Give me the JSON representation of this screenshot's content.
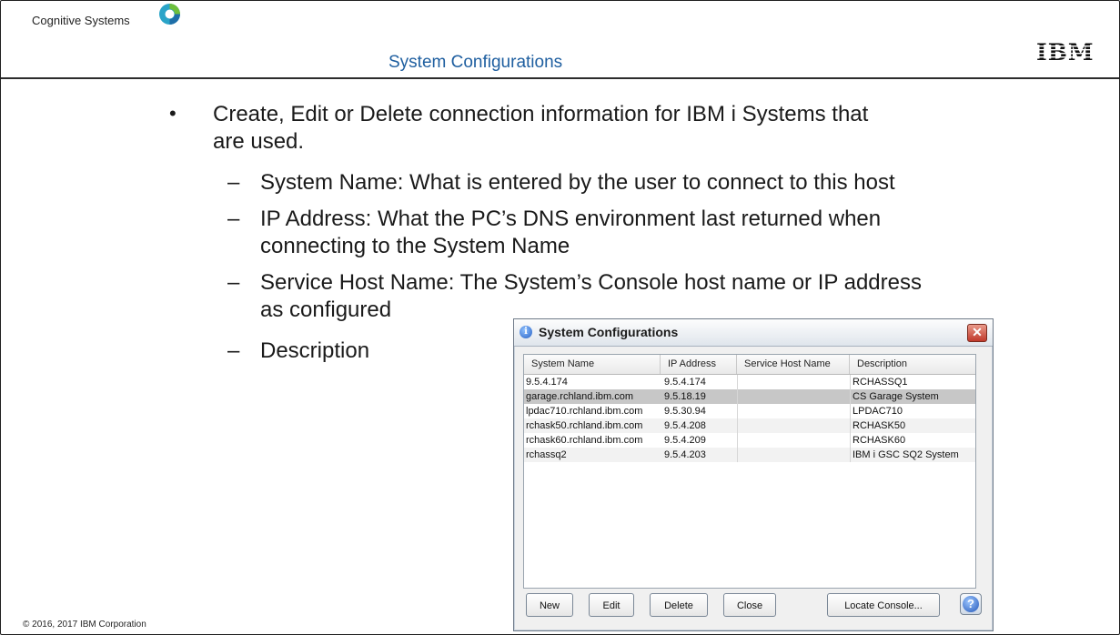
{
  "header": {
    "brand": "Cognitive Systems",
    "title": "System Configurations",
    "ibm_logo": "IBM"
  },
  "bullets": {
    "main_line1": "Create, Edit or Delete connection information for IBM i Systems that",
    "main_line2": "are used.",
    "sub1": "System Name:  What is entered by the user to connect to this host",
    "sub2_line1": "IP Address:  What the PC’s DNS environment last returned when",
    "sub2_line2": "connecting to the System Name",
    "sub3_line1": "Service Host Name:  The System’s Console host name or IP address",
    "sub3_line2": "as configured",
    "sub4": "Description"
  },
  "footer": {
    "copyright": "© 2016, 2017 IBM Corporation"
  },
  "dialog": {
    "title": "System Configurations",
    "columns": [
      "System Name",
      "IP Address",
      "Service Host Name",
      "Description"
    ],
    "rows": [
      [
        "9.5.4.174",
        "9.5.4.174",
        "",
        "RCHASSQ1"
      ],
      [
        "garage.rchland.ibm.com",
        "9.5.18.19",
        "",
        "CS Garage System"
      ],
      [
        "lpdac710.rchland.ibm.com",
        "9.5.30.94",
        "",
        "LPDAC710"
      ],
      [
        "rchask50.rchland.ibm.com",
        "9.5.4.208",
        "",
        "RCHASK50"
      ],
      [
        "rchask60.rchland.ibm.com",
        "9.5.4.209",
        "",
        "RCHASK60"
      ],
      [
        "rchassq2",
        "9.5.4.203",
        "",
        "IBM i GSC SQ2 System"
      ]
    ],
    "buttons": {
      "new": "New",
      "edit": "Edit",
      "delete": "Delete",
      "close": "Close",
      "locate": "Locate Console..."
    },
    "help_glyph": "?",
    "close_glyph": "✕",
    "info_glyph": "i"
  },
  "colors": {
    "title": "#1f5fa0",
    "selected_row": "#c7c7c7"
  },
  "icons": [
    "cognitive-systems-logo-icon",
    "ibm-logo-icon",
    "info-icon",
    "close-icon",
    "help-icon"
  ]
}
